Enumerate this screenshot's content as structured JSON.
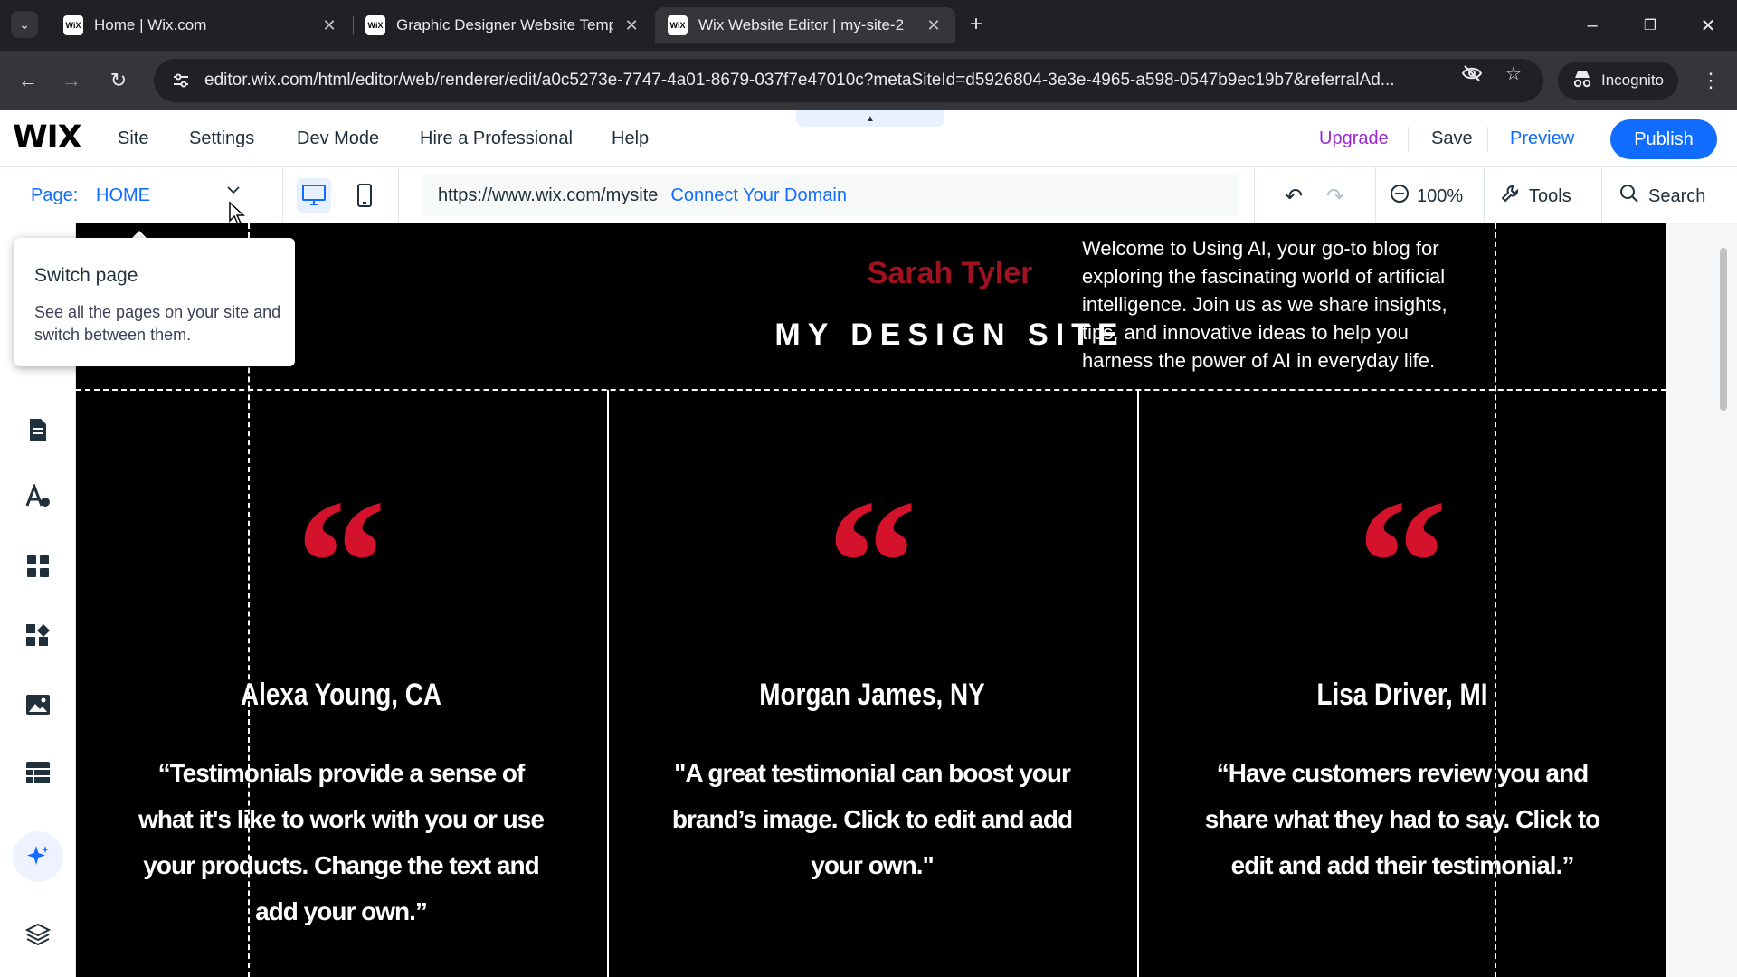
{
  "browser": {
    "tabs": [
      {
        "title": "Home | Wix.com",
        "active": false
      },
      {
        "title": "Graphic Designer Website Temp",
        "active": false
      },
      {
        "title": "Wix Website Editor | my-site-2",
        "active": true
      }
    ],
    "favicon_text": "WiX",
    "new_tab_icon": "plus-icon",
    "address": "editor.wix.com/html/editor/web/renderer/edit/a0c5273e-7747-4a01-8679-037f7e47010c?metaSiteId=d5926804-3e3e-4965-a598-0547b9ec19b7&referralAd...",
    "incognito_label": "Incognito"
  },
  "wix_top": {
    "logo": "WIX",
    "menu": [
      "Site",
      "Settings",
      "Dev Mode",
      "Hire a Professional",
      "Help"
    ],
    "upgrade": "Upgrade",
    "save": "Save",
    "preview": "Preview",
    "publish": "Publish"
  },
  "wix_bar2": {
    "page_label": "Page:",
    "page_name": "HOME",
    "site_url": "https://www.wix.com/mysite",
    "connect_domain": "Connect Your Domain",
    "zoom": "100%",
    "tools": "Tools",
    "search": "Search"
  },
  "tooltip": {
    "title": "Switch page",
    "text": "See all the pages on your site and switch between them."
  },
  "site": {
    "brand_name": "Sarah Tyler",
    "site_title": "MY DESIGN SITE",
    "welcome": "Welcome to Using AI, your go-to blog for exploring the fascinating world of artificial intelligence. Join us as we share insights, tips, and innovative ideas to help you harness the power of AI in everyday life.",
    "quote_glyph": "“",
    "testimonials": [
      {
        "name": "Alexa Young, CA",
        "text": "“Testimonials provide a sense of what it's like to work with you or use your products. Change the text and add your own.”"
      },
      {
        "name": "Morgan James, NY",
        "text": "\"A great testimonial can boost your brand’s image. Click to edit and add your own.\""
      },
      {
        "name": "Lisa Driver, MI",
        "text": "“Have customers review you and share what they had to say. Click to edit and add their testimonial.”"
      }
    ]
  },
  "colors": {
    "wix_blue": "#116dff",
    "upgrade_purple": "#9a27d5",
    "brand_red": "#a01220",
    "quote_red": "#d5122b"
  }
}
